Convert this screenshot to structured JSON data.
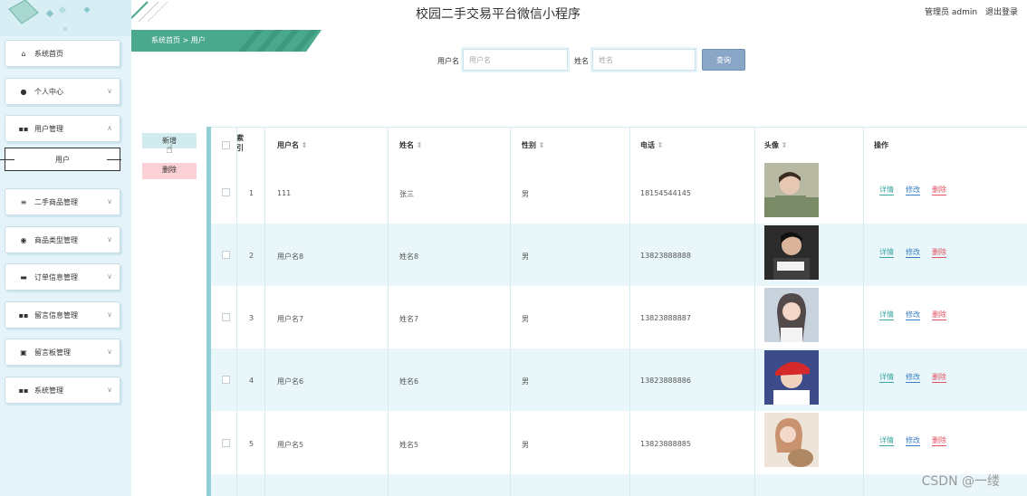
{
  "app": {
    "title": "校园二手交易平台微信小程序",
    "user_role": "管理员 admin",
    "logout": "退出登录"
  },
  "sidebar": {
    "items": [
      {
        "label": "系统首页",
        "icon": "home-icon"
      },
      {
        "label": "个人中心",
        "icon": "user-icon"
      },
      {
        "label": "用户管理",
        "icon": "grid-icon"
      },
      {
        "label": "用户",
        "icon": ""
      },
      {
        "label": "二手商品管理",
        "icon": "list-icon"
      },
      {
        "label": "商品类型管理",
        "icon": "pin-icon"
      },
      {
        "label": "订单信息管理",
        "icon": "card-icon"
      },
      {
        "label": "留言信息管理",
        "icon": "grid-icon"
      },
      {
        "label": "留言板管理",
        "icon": "print-icon"
      },
      {
        "label": "系统管理",
        "icon": "grid-icon"
      }
    ]
  },
  "breadcrumb": {
    "home": "系统首页",
    "separator": ">",
    "current": "用户"
  },
  "search": {
    "username_label": "用户名",
    "username_placeholder": "用户名",
    "name_label": "姓名",
    "name_placeholder": "姓名",
    "button": "查询"
  },
  "actions": {
    "add": "新增",
    "delete": "删除"
  },
  "table": {
    "headers": {
      "index": "索引",
      "username": "用户名",
      "name": "姓名",
      "gender": "性别",
      "phone": "电话",
      "avatar": "头像",
      "ops": "操作"
    },
    "sort_icon": "⇕",
    "rows": [
      {
        "index": "1",
        "username": "111",
        "name": "张三",
        "gender": "男",
        "phone": "18154544145",
        "avatar_color": "#a7a08a"
      },
      {
        "index": "2",
        "username": "用户名8",
        "name": "姓名8",
        "gender": "男",
        "phone": "13823888888",
        "avatar_color": "#2d3436"
      },
      {
        "index": "3",
        "username": "用户名7",
        "name": "姓名7",
        "gender": "男",
        "phone": "13823888887",
        "avatar_color": "#b7c3d3"
      },
      {
        "index": "4",
        "username": "用户名6",
        "name": "姓名6",
        "gender": "男",
        "phone": "13823888886",
        "avatar_color": "#c0392b"
      },
      {
        "index": "5",
        "username": "用户名5",
        "name": "姓名5",
        "gender": "男",
        "phone": "13823888885",
        "avatar_color": "#e8c9b8"
      }
    ],
    "ops": {
      "detail": "详情",
      "edit": "修改",
      "delete": "删除"
    }
  },
  "watermark": "CSDN @一缕",
  "colors": {
    "accent_green": "#4aa88c",
    "sidebar_bg": "#e3f3f9",
    "button_blue": "#8aa6c6",
    "row_alt": "#e9f6fa"
  }
}
